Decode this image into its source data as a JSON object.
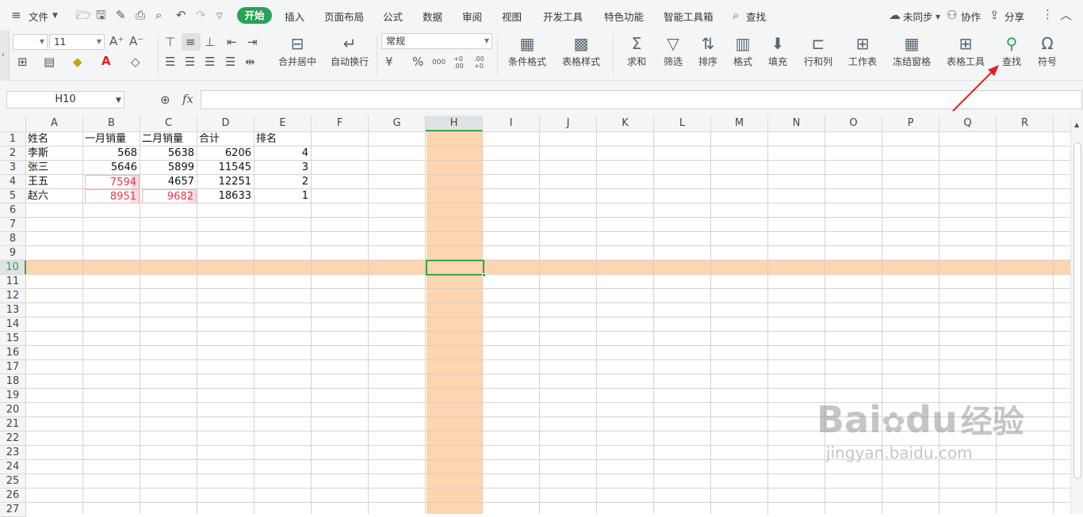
{
  "menu": {
    "file_label": "文件",
    "tabs": [
      "插入",
      "页面布局",
      "公式",
      "数据",
      "审阅",
      "视图",
      "开发工具",
      "特色功能",
      "智能工具箱"
    ],
    "active_tab": "开始",
    "search_label": "查找",
    "sync_label": "未同步",
    "collab_label": "协作",
    "share_label": "分享"
  },
  "ribbon": {
    "font_name": "",
    "font_size": "11",
    "number_format": "常规",
    "merge_label": "合并居中",
    "wrap_label": "自动换行",
    "cond_format_label": "条件格式",
    "table_style_label": "表格样式",
    "sum_label": "求和",
    "filter_label": "筛选",
    "sort_label": "排序",
    "format_label": "格式",
    "fill_label": "填充",
    "rowcol_label": "行和列",
    "sheet_label": "工作表",
    "freeze_label": "冻结窗格",
    "tabletools_label": "表格工具",
    "find_label": "查找",
    "symbol_label": "符号",
    "percent_glyph": "%",
    "thousands_glyph": "000",
    "dec_inc_glyph": "+0 .00",
    "dec_dec_glyph": ".00 +0"
  },
  "formula_bar": {
    "name_box": "H10",
    "fx_label": "fx",
    "content": ""
  },
  "grid": {
    "columns": [
      "A",
      "B",
      "C",
      "D",
      "E",
      "F",
      "G",
      "H",
      "I",
      "J",
      "K",
      "L",
      "M",
      "N",
      "O",
      "P",
      "Q",
      "R"
    ],
    "rows": [
      "1",
      "2",
      "3",
      "4",
      "5",
      "6",
      "7",
      "8",
      "9",
      "10",
      "11",
      "12",
      "13",
      "14",
      "15",
      "16",
      "17",
      "18",
      "19",
      "20",
      "21",
      "22",
      "23",
      "24",
      "25",
      "26",
      "27"
    ],
    "selected_cell": "H10",
    "highlight_color": "#fdd5b1",
    "selection_color": "#3aa34a",
    "header_row": [
      "姓名",
      "一月销量",
      "二月销量",
      "合计",
      "排名"
    ],
    "data_rows": [
      [
        "李斯",
        "568",
        "5638",
        "6206",
        "4"
      ],
      [
        "张三",
        "5646",
        "5899",
        "11545",
        "3"
      ],
      [
        "王五",
        "7594",
        "4657",
        "12251",
        "2"
      ],
      [
        "赵六",
        "8951",
        "9682",
        "18633",
        "1"
      ]
    ]
  },
  "watermark": {
    "brand": "Bai",
    "brand2": "du",
    "cn": "经验",
    "url": "jingyan.baidu.com"
  }
}
